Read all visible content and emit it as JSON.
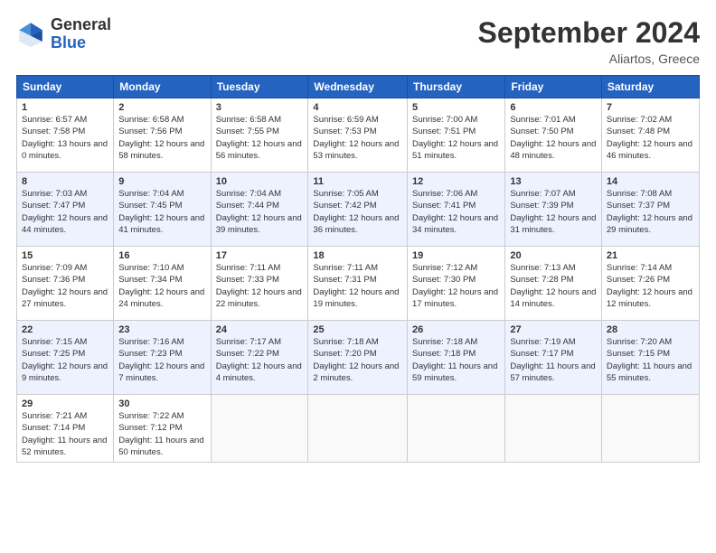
{
  "header": {
    "logo_general": "General",
    "logo_blue": "Blue",
    "month_title": "September 2024",
    "location": "Aliartos, Greece"
  },
  "weekdays": [
    "Sunday",
    "Monday",
    "Tuesday",
    "Wednesday",
    "Thursday",
    "Friday",
    "Saturday"
  ],
  "weeks": [
    [
      {
        "day": "1",
        "sunrise": "Sunrise: 6:57 AM",
        "sunset": "Sunset: 7:58 PM",
        "daylight": "Daylight: 13 hours and 0 minutes."
      },
      {
        "day": "2",
        "sunrise": "Sunrise: 6:58 AM",
        "sunset": "Sunset: 7:56 PM",
        "daylight": "Daylight: 12 hours and 58 minutes."
      },
      {
        "day": "3",
        "sunrise": "Sunrise: 6:58 AM",
        "sunset": "Sunset: 7:55 PM",
        "daylight": "Daylight: 12 hours and 56 minutes."
      },
      {
        "day": "4",
        "sunrise": "Sunrise: 6:59 AM",
        "sunset": "Sunset: 7:53 PM",
        "daylight": "Daylight: 12 hours and 53 minutes."
      },
      {
        "day": "5",
        "sunrise": "Sunrise: 7:00 AM",
        "sunset": "Sunset: 7:51 PM",
        "daylight": "Daylight: 12 hours and 51 minutes."
      },
      {
        "day": "6",
        "sunrise": "Sunrise: 7:01 AM",
        "sunset": "Sunset: 7:50 PM",
        "daylight": "Daylight: 12 hours and 48 minutes."
      },
      {
        "day": "7",
        "sunrise": "Sunrise: 7:02 AM",
        "sunset": "Sunset: 7:48 PM",
        "daylight": "Daylight: 12 hours and 46 minutes."
      }
    ],
    [
      {
        "day": "8",
        "sunrise": "Sunrise: 7:03 AM",
        "sunset": "Sunset: 7:47 PM",
        "daylight": "Daylight: 12 hours and 44 minutes."
      },
      {
        "day": "9",
        "sunrise": "Sunrise: 7:04 AM",
        "sunset": "Sunset: 7:45 PM",
        "daylight": "Daylight: 12 hours and 41 minutes."
      },
      {
        "day": "10",
        "sunrise": "Sunrise: 7:04 AM",
        "sunset": "Sunset: 7:44 PM",
        "daylight": "Daylight: 12 hours and 39 minutes."
      },
      {
        "day": "11",
        "sunrise": "Sunrise: 7:05 AM",
        "sunset": "Sunset: 7:42 PM",
        "daylight": "Daylight: 12 hours and 36 minutes."
      },
      {
        "day": "12",
        "sunrise": "Sunrise: 7:06 AM",
        "sunset": "Sunset: 7:41 PM",
        "daylight": "Daylight: 12 hours and 34 minutes."
      },
      {
        "day": "13",
        "sunrise": "Sunrise: 7:07 AM",
        "sunset": "Sunset: 7:39 PM",
        "daylight": "Daylight: 12 hours and 31 minutes."
      },
      {
        "day": "14",
        "sunrise": "Sunrise: 7:08 AM",
        "sunset": "Sunset: 7:37 PM",
        "daylight": "Daylight: 12 hours and 29 minutes."
      }
    ],
    [
      {
        "day": "15",
        "sunrise": "Sunrise: 7:09 AM",
        "sunset": "Sunset: 7:36 PM",
        "daylight": "Daylight: 12 hours and 27 minutes."
      },
      {
        "day": "16",
        "sunrise": "Sunrise: 7:10 AM",
        "sunset": "Sunset: 7:34 PM",
        "daylight": "Daylight: 12 hours and 24 minutes."
      },
      {
        "day": "17",
        "sunrise": "Sunrise: 7:11 AM",
        "sunset": "Sunset: 7:33 PM",
        "daylight": "Daylight: 12 hours and 22 minutes."
      },
      {
        "day": "18",
        "sunrise": "Sunrise: 7:11 AM",
        "sunset": "Sunset: 7:31 PM",
        "daylight": "Daylight: 12 hours and 19 minutes."
      },
      {
        "day": "19",
        "sunrise": "Sunrise: 7:12 AM",
        "sunset": "Sunset: 7:30 PM",
        "daylight": "Daylight: 12 hours and 17 minutes."
      },
      {
        "day": "20",
        "sunrise": "Sunrise: 7:13 AM",
        "sunset": "Sunset: 7:28 PM",
        "daylight": "Daylight: 12 hours and 14 minutes."
      },
      {
        "day": "21",
        "sunrise": "Sunrise: 7:14 AM",
        "sunset": "Sunset: 7:26 PM",
        "daylight": "Daylight: 12 hours and 12 minutes."
      }
    ],
    [
      {
        "day": "22",
        "sunrise": "Sunrise: 7:15 AM",
        "sunset": "Sunset: 7:25 PM",
        "daylight": "Daylight: 12 hours and 9 minutes."
      },
      {
        "day": "23",
        "sunrise": "Sunrise: 7:16 AM",
        "sunset": "Sunset: 7:23 PM",
        "daylight": "Daylight: 12 hours and 7 minutes."
      },
      {
        "day": "24",
        "sunrise": "Sunrise: 7:17 AM",
        "sunset": "Sunset: 7:22 PM",
        "daylight": "Daylight: 12 hours and 4 minutes."
      },
      {
        "day": "25",
        "sunrise": "Sunrise: 7:18 AM",
        "sunset": "Sunset: 7:20 PM",
        "daylight": "Daylight: 12 hours and 2 minutes."
      },
      {
        "day": "26",
        "sunrise": "Sunrise: 7:18 AM",
        "sunset": "Sunset: 7:18 PM",
        "daylight": "Daylight: 11 hours and 59 minutes."
      },
      {
        "day": "27",
        "sunrise": "Sunrise: 7:19 AM",
        "sunset": "Sunset: 7:17 PM",
        "daylight": "Daylight: 11 hours and 57 minutes."
      },
      {
        "day": "28",
        "sunrise": "Sunrise: 7:20 AM",
        "sunset": "Sunset: 7:15 PM",
        "daylight": "Daylight: 11 hours and 55 minutes."
      }
    ],
    [
      {
        "day": "29",
        "sunrise": "Sunrise: 7:21 AM",
        "sunset": "Sunset: 7:14 PM",
        "daylight": "Daylight: 11 hours and 52 minutes."
      },
      {
        "day": "30",
        "sunrise": "Sunrise: 7:22 AM",
        "sunset": "Sunset: 7:12 PM",
        "daylight": "Daylight: 11 hours and 50 minutes."
      },
      null,
      null,
      null,
      null,
      null
    ]
  ]
}
